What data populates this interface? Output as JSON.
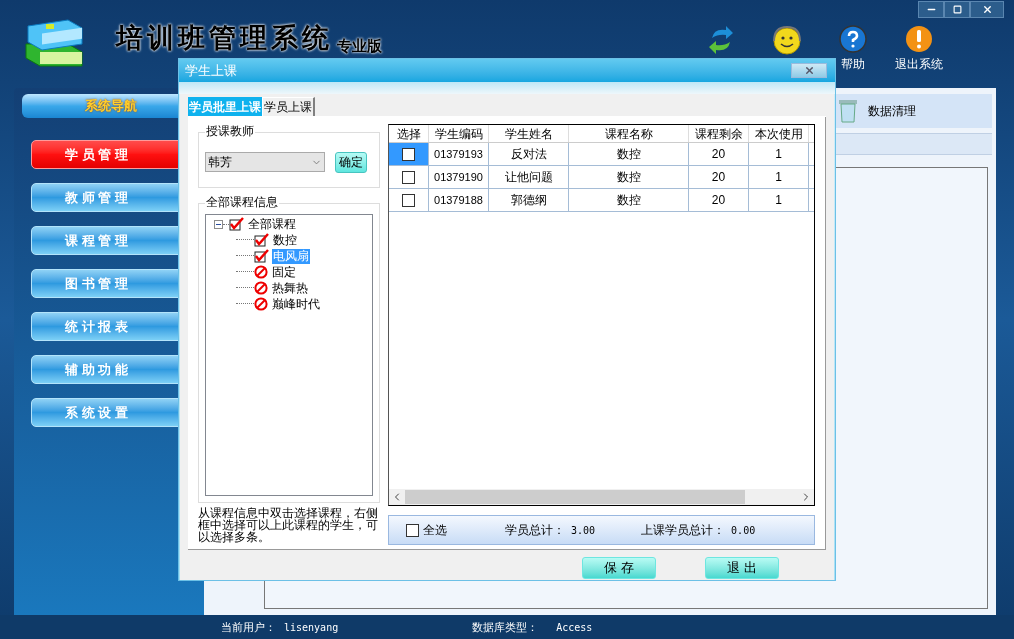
{
  "app": {
    "title": "培训班管理系统",
    "edition": "专业版"
  },
  "toolbar": [
    {
      "kind": "sync"
    },
    {
      "kind": "support"
    },
    {
      "kind": "help",
      "label": "帮助"
    },
    {
      "kind": "exit",
      "label": "退出系统"
    }
  ],
  "nav": {
    "title": "系统导航",
    "items": [
      {
        "label": "学 员 管 理",
        "selected": true
      },
      {
        "label": "教 师 管 理",
        "selected": false
      },
      {
        "label": "课 程 管 理",
        "selected": false
      },
      {
        "label": "图 书 管 理",
        "selected": false
      },
      {
        "label": "统 计 报 表",
        "selected": false
      },
      {
        "label": "辅 助 功 能",
        "selected": false
      },
      {
        "label": "系 统 设 置",
        "selected": false
      }
    ]
  },
  "content": {
    "tools": [
      {
        "kind": "cleanup",
        "label": "数据清理"
      }
    ]
  },
  "status_bar": [
    {
      "label": "当前用户：",
      "value": "lisenyang"
    },
    {
      "label": "数据库类型：",
      "value": "Access"
    }
  ],
  "dialog": {
    "title": "学生上课",
    "tabs": [
      {
        "label": "学员批里上课",
        "selected": true
      },
      {
        "label": "学员上课",
        "selected": false
      }
    ],
    "teacher": {
      "legend": "授课教师",
      "value": "韩芳",
      "confirm": "确定"
    },
    "courses": {
      "legend": "全部课程信息",
      "tree": [
        {
          "label": "全部课程",
          "checked": true,
          "expanded": true,
          "selected": false,
          "children": [
            {
              "label": "数控",
              "checked": true,
              "selected": false
            },
            {
              "label": "电风扇",
              "checked": true,
              "selected": true
            },
            {
              "label": "固定",
              "checked": false,
              "selected": false
            },
            {
              "label": "热舞热",
              "checked": false,
              "selected": false
            },
            {
              "label": "巅峰时代",
              "checked": false,
              "selected": false
            }
          ]
        }
      ]
    },
    "hint": "从课程信息中双击选择课程，右侧框中选择可以上此课程的学生，可以选择多条。",
    "table": {
      "select_column": "选择",
      "columns": [
        "学生编码",
        "学生姓名",
        "课程名称",
        "课程剩余",
        "本次使用"
      ],
      "rows": [
        {
          "selected": true,
          "checked": false,
          "cells": [
            "01379193",
            "反对法",
            "数控",
            "20",
            "1"
          ]
        },
        {
          "selected": false,
          "checked": false,
          "cells": [
            "01379190",
            "让他问题",
            "数控",
            "20",
            "1"
          ]
        },
        {
          "selected": false,
          "checked": false,
          "cells": [
            "01379188",
            "郭德纲",
            "数控",
            "20",
            "1"
          ]
        }
      ]
    },
    "footer": {
      "select_all": {
        "label": "全选",
        "checked": false
      },
      "totals": [
        {
          "label": "学员总计：",
          "value": "3.00"
        },
        {
          "label": "上课学员总计：",
          "value": "0.00"
        }
      ]
    },
    "buttons": [
      "保 存",
      "退 出"
    ]
  }
}
